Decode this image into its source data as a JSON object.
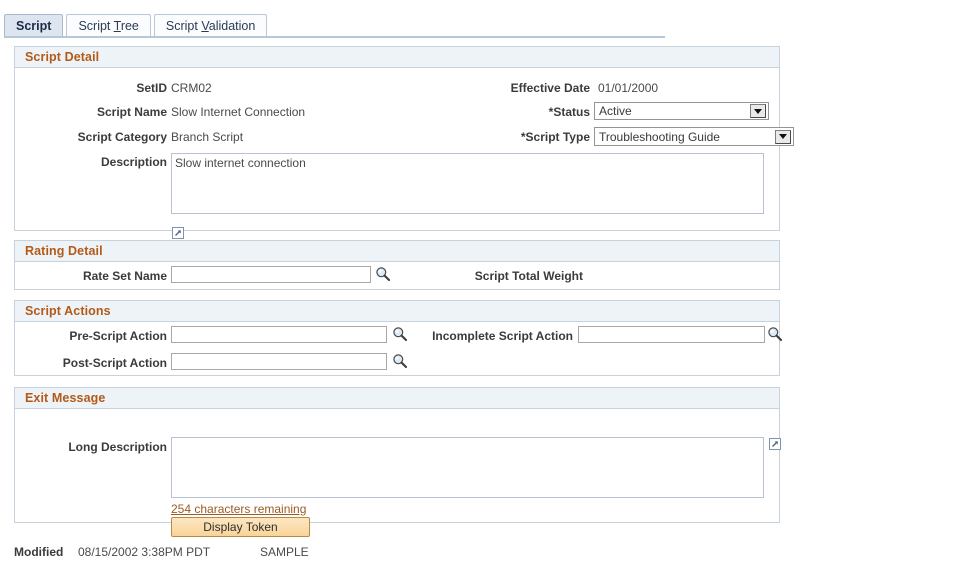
{
  "tabs": [
    {
      "label": "Script",
      "accel": "",
      "active": true
    },
    {
      "label": "Script Tree",
      "accel": "T",
      "active": false
    },
    {
      "label": "Script Validation",
      "accel": "V",
      "active": false
    }
  ],
  "script_detail": {
    "title": "Script Detail",
    "setid_label": "SetID",
    "setid_value": "CRM02",
    "script_name_label": "Script Name",
    "script_name_value": "Slow Internet Connection",
    "script_category_label": "Script Category",
    "script_category_value": "Branch Script",
    "description_label": "Description",
    "description_value": "Slow internet connection",
    "effective_date_label": "Effective Date",
    "effective_date_value": "01/01/2000",
    "status_label": "*Status",
    "status_value": "Active",
    "script_type_label": "*Script Type",
    "script_type_value": "Troubleshooting Guide",
    "expand_icon": "expand-description-icon"
  },
  "rating_detail": {
    "title": "Rating Detail",
    "rate_set_name_label": "Rate Set Name",
    "rate_set_name_value": "",
    "rate_set_name_placeholder": "",
    "script_total_weight_label": "Script Total Weight",
    "script_total_weight_value": "",
    "lookup_icon": "magnifier-lookup-icon"
  },
  "script_actions": {
    "title": "Script Actions",
    "pre_script_action_label": "Pre-Script Action",
    "pre_script_action_value": "",
    "post_script_action_label": "Post-Script Action",
    "post_script_action_value": "",
    "incomplete_script_action_label": "Incomplete Script Action",
    "incomplete_script_action_value": "",
    "lookup_icon": "magnifier-lookup-icon"
  },
  "exit_message": {
    "title": "Exit Message",
    "long_description_label": "Long Description",
    "long_description_value": "",
    "characters_remaining_link": "254 characters remaining",
    "display_token_button": "Display Token",
    "expand_icon": "expand-long-description-icon"
  },
  "footer": {
    "modified_label": "Modified",
    "modified_value": "08/15/2002  3:38PM PDT",
    "user": "SAMPLE"
  },
  "colors": {
    "panel_title": "#b35a19",
    "panel_border": "#c8d2dc",
    "panel_header_bg": "#eef3f7",
    "active_tab_bg": "#dde6f0",
    "link": "#9c5a22",
    "button_face": "#f8d49a"
  }
}
